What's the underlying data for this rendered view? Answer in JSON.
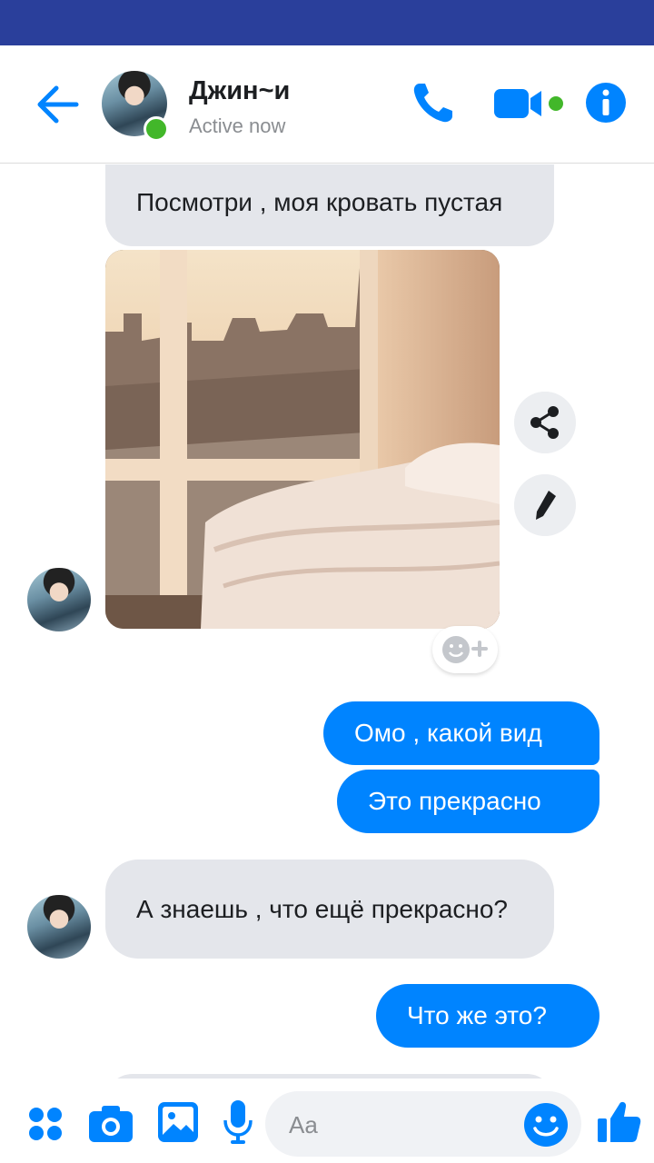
{
  "header": {
    "contact_name": "Джин~и",
    "status": "Active now"
  },
  "messages": [
    {
      "direction": "incoming",
      "text": "Посмотри , моя кровать пустая"
    },
    {
      "direction": "incoming",
      "type": "photo",
      "alt": "bedroom with window view"
    },
    {
      "direction": "outgoing",
      "text": "Омо , какой вид"
    },
    {
      "direction": "outgoing",
      "text": "Это прекрасно"
    },
    {
      "direction": "incoming",
      "text": "А знаешь , что ещё прекрасно?"
    },
    {
      "direction": "outgoing",
      "text": "Что же это?"
    }
  ],
  "composer": {
    "placeholder": "Aa"
  },
  "colors": {
    "status_bar": "#2a3f9b",
    "accent": "#0084ff",
    "incoming_bubble": "#e4e6eb",
    "online": "#42b72a"
  },
  "icons": [
    "back-arrow-icon",
    "phone-icon",
    "video-camera-icon",
    "info-icon",
    "share-icon",
    "pencil-icon",
    "add-reaction-icon",
    "menu-dots-icon",
    "camera-icon",
    "gallery-icon",
    "microphone-icon",
    "emoji-icon",
    "thumbs-up-icon"
  ]
}
